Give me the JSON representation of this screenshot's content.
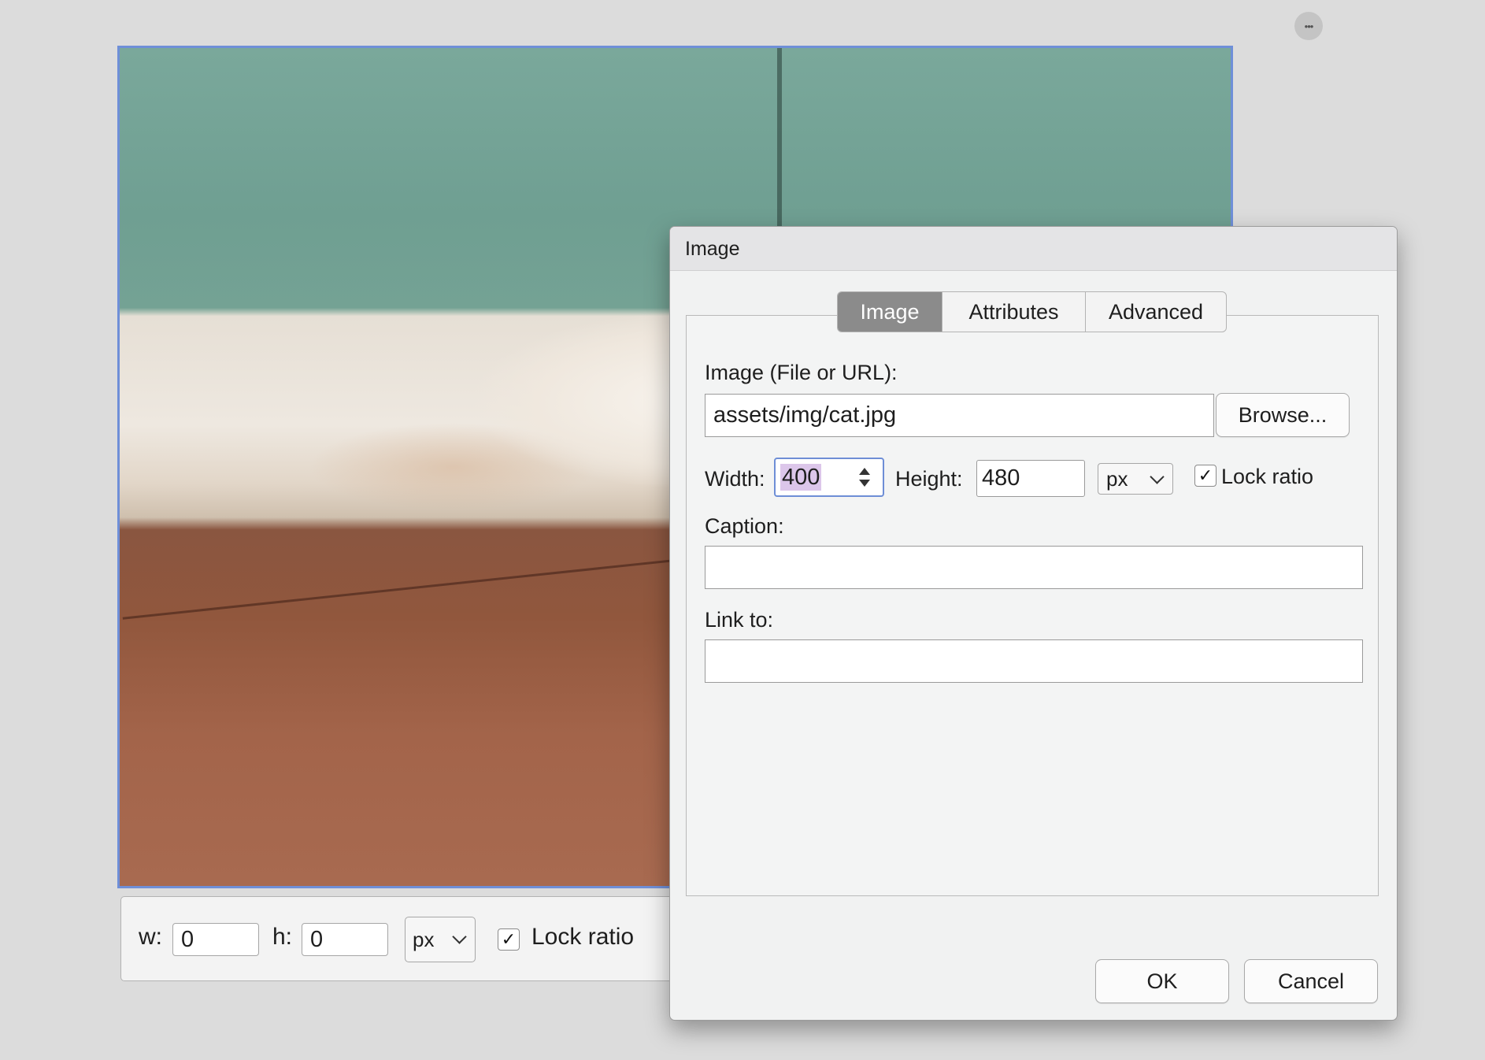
{
  "toolbar": {
    "more_icon": "ellipsis-icon",
    "more_glyph": "•••"
  },
  "resize_bar": {
    "width_label": "w:",
    "width_value": "0",
    "height_label": "h:",
    "height_value": "0",
    "unit": "px",
    "lock_ratio_label": "Lock ratio",
    "lock_ratio_checked": true
  },
  "dialog": {
    "title": "Image",
    "tabs": [
      {
        "label": "Image",
        "active": true
      },
      {
        "label": "Attributes",
        "active": false
      },
      {
        "label": "Advanced",
        "active": false
      }
    ],
    "image_source_label": "Image (File or URL):",
    "image_source_value": "assets/img/cat.jpg",
    "browse_label": "Browse...",
    "width_label": "Width:",
    "width_value": "400",
    "height_label": "Height:",
    "height_value": "480",
    "unit": "px",
    "lock_ratio_label": "Lock ratio",
    "lock_ratio_checked": true,
    "caption_label": "Caption:",
    "caption_value": "",
    "link_label": "Link to:",
    "link_value": "",
    "ok_label": "OK",
    "cancel_label": "Cancel"
  },
  "colors": {
    "focus_border": "#6e8ed6",
    "active_tab": "#8b8b8b",
    "selection": "#dcc6ea"
  }
}
